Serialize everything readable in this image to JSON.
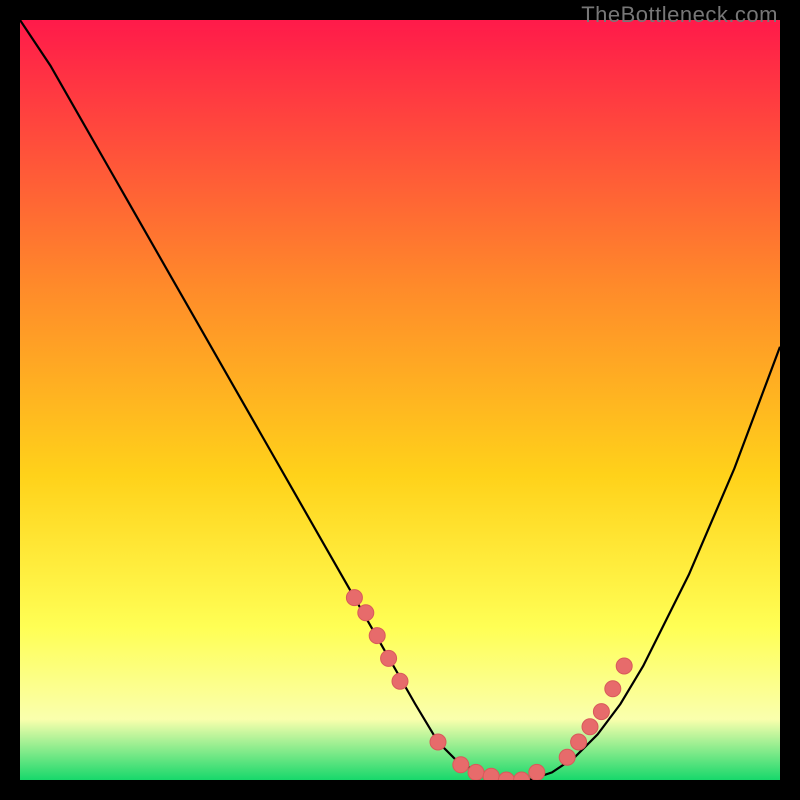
{
  "watermark": "TheBottleneck.com",
  "colors": {
    "gradient_top": "#ff1a4a",
    "gradient_mid1": "#ff6a2a",
    "gradient_mid2": "#ffd21a",
    "gradient_mid3": "#ffff55",
    "gradient_mid4": "#faffad",
    "gradient_bottom": "#17d86b",
    "curve": "#000000",
    "marker_fill": "#e76b6b",
    "marker_stroke": "#d85a5a",
    "background": "#000000"
  },
  "chart_data": {
    "type": "line",
    "title": "",
    "xlabel": "",
    "ylabel": "",
    "xlim": [
      0,
      100
    ],
    "ylim": [
      0,
      100
    ],
    "series": [
      {
        "name": "bottleneck-curve",
        "x": [
          0,
          4,
          8,
          12,
          16,
          20,
          24,
          28,
          32,
          36,
          40,
          44,
          48,
          52,
          55,
          58,
          61,
          64,
          67,
          70,
          73,
          76,
          79,
          82,
          85,
          88,
          91,
          94,
          97,
          100
        ],
        "values": [
          100,
          94,
          87,
          80,
          73,
          66,
          59,
          52,
          45,
          38,
          31,
          24,
          17,
          10,
          5,
          2,
          1,
          0,
          0,
          1,
          3,
          6,
          10,
          15,
          21,
          27,
          34,
          41,
          49,
          57
        ]
      }
    ],
    "markers": {
      "name": "highlight-points",
      "x": [
        44,
        45.5,
        47,
        48.5,
        50,
        55,
        58,
        60,
        62,
        64,
        66,
        68,
        72,
        73.5,
        75,
        76.5,
        78,
        79.5
      ],
      "y": [
        24,
        22,
        19,
        16,
        13,
        5,
        2,
        1,
        0.5,
        0,
        0,
        1,
        3,
        5,
        7,
        9,
        12,
        15
      ]
    }
  }
}
